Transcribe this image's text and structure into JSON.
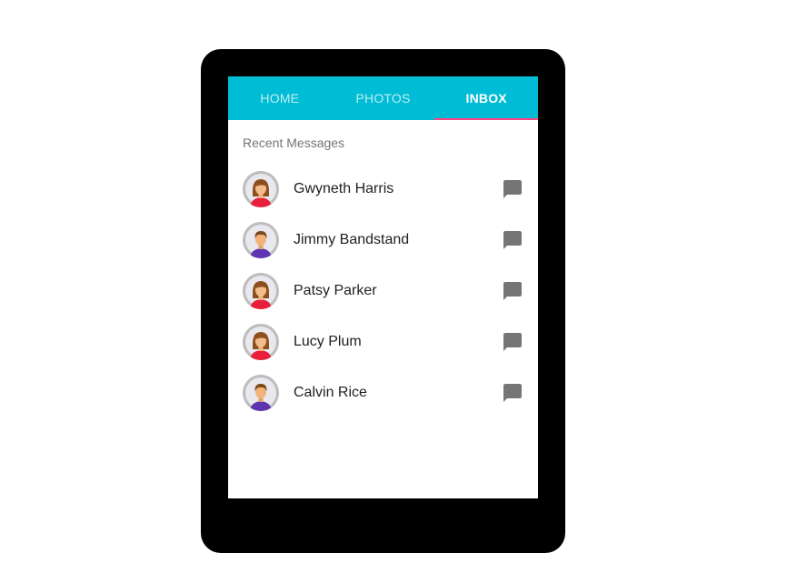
{
  "tabs": [
    {
      "label": "HOME",
      "active": false
    },
    {
      "label": "PHOTOS",
      "active": false
    },
    {
      "label": "INBOX",
      "active": true
    }
  ],
  "subheader": "Recent Messages",
  "messages": [
    {
      "name": "Gwyneth Harris",
      "avatar": "female-avatar-icon",
      "action": "chat-bubble-icon"
    },
    {
      "name": "Jimmy Bandstand",
      "avatar": "male-avatar-icon",
      "action": "chat-bubble-icon"
    },
    {
      "name": "Patsy Parker",
      "avatar": "female-avatar-icon",
      "action": "chat-bubble-icon"
    },
    {
      "name": "Lucy Plum",
      "avatar": "female-avatar-icon",
      "action": "chat-bubble-icon"
    },
    {
      "name": "Calvin Rice",
      "avatar": "male-avatar-icon",
      "action": "chat-bubble-icon"
    }
  ],
  "colors": {
    "tab_bar": "#00bcd4",
    "tab_indicator": "#ff4081",
    "device_frame": "#000000",
    "icon_gray": "#757575"
  }
}
